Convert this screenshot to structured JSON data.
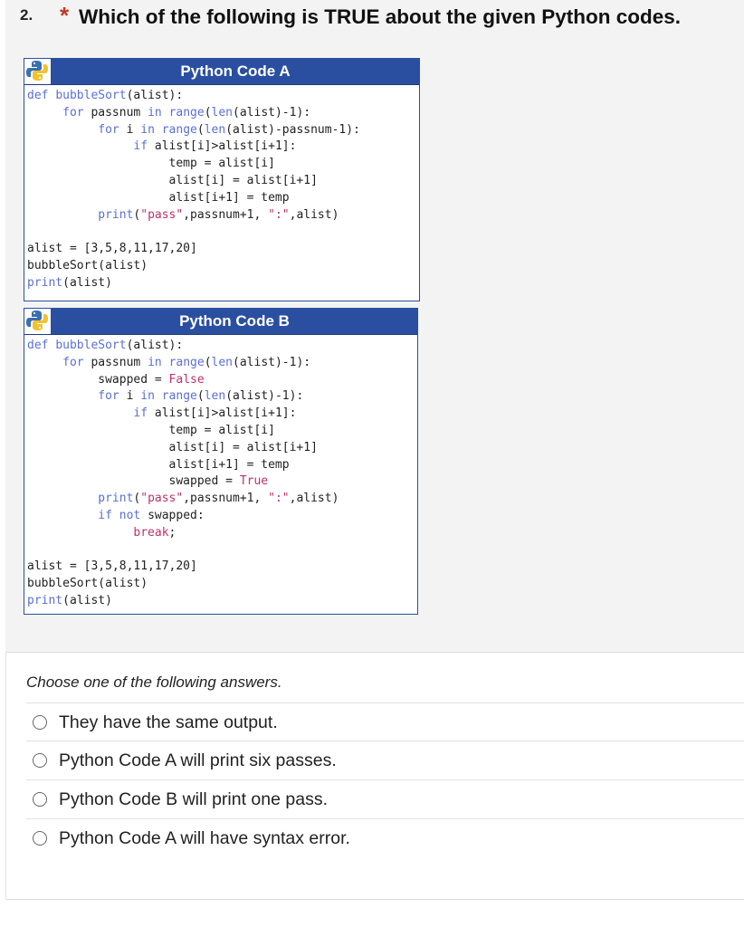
{
  "question": {
    "number": "2.",
    "required_marker": "*",
    "text": "Which of the following is TRUE about the given Python codes."
  },
  "code_a": {
    "title": "Python Code A",
    "lines": [
      [
        [
          "kw",
          "def "
        ],
        [
          "fn",
          "bubbleSort"
        ],
        [
          "",
          "(alist):"
        ]
      ],
      [
        [
          "",
          "     "
        ],
        [
          "kw",
          "for"
        ],
        [
          "",
          " passnum "
        ],
        [
          "kw",
          "in"
        ],
        [
          "",
          " "
        ],
        [
          "fn",
          "range"
        ],
        [
          "",
          "("
        ],
        [
          "fn",
          "len"
        ],
        [
          "",
          "(alist)-1):"
        ]
      ],
      [
        [
          "",
          "          "
        ],
        [
          "kw",
          "for"
        ],
        [
          "",
          " i "
        ],
        [
          "kw",
          "in"
        ],
        [
          "",
          " "
        ],
        [
          "fn",
          "range"
        ],
        [
          "",
          "("
        ],
        [
          "fn",
          "len"
        ],
        [
          "",
          "(alist)-passnum-1):"
        ]
      ],
      [
        [
          "",
          "               "
        ],
        [
          "kw",
          "if"
        ],
        [
          "",
          " alist[i]>alist[i+1]:"
        ]
      ],
      [
        [
          "",
          "                    temp = alist[i]"
        ]
      ],
      [
        [
          "",
          "                    alist[i] = alist[i+1]"
        ]
      ],
      [
        [
          "",
          "                    alist[i+1] = temp"
        ]
      ],
      [
        [
          "",
          "          "
        ],
        [
          "fn",
          "print"
        ],
        [
          "",
          "("
        ],
        [
          "str",
          "\"pass\""
        ],
        [
          "",
          ",passnum+1, "
        ],
        [
          "str",
          "\":\""
        ],
        [
          "",
          ",alist)"
        ]
      ],
      [
        [
          "",
          ""
        ]
      ],
      [
        [
          "",
          "alist = [3,5,8,11,17,20]"
        ]
      ],
      [
        [
          "",
          "bubbleSort(alist)"
        ]
      ],
      [
        [
          "fn",
          "print"
        ],
        [
          "",
          "(alist)"
        ]
      ]
    ]
  },
  "code_b": {
    "title": "Python Code B",
    "lines": [
      [
        [
          "kw",
          "def "
        ],
        [
          "fn",
          "bubbleSort"
        ],
        [
          "",
          "(alist):"
        ]
      ],
      [
        [
          "",
          "     "
        ],
        [
          "kw",
          "for"
        ],
        [
          "",
          " passnum "
        ],
        [
          "kw",
          "in"
        ],
        [
          "",
          " "
        ],
        [
          "fn",
          "range"
        ],
        [
          "",
          "("
        ],
        [
          "fn",
          "len"
        ],
        [
          "",
          "(alist)-1):"
        ]
      ],
      [
        [
          "",
          "          swapped = "
        ],
        [
          "const",
          "False"
        ]
      ],
      [
        [
          "",
          "          "
        ],
        [
          "kw",
          "for"
        ],
        [
          "",
          " i "
        ],
        [
          "kw",
          "in"
        ],
        [
          "",
          " "
        ],
        [
          "fn",
          "range"
        ],
        [
          "",
          "("
        ],
        [
          "fn",
          "len"
        ],
        [
          "",
          "(alist)-1):"
        ]
      ],
      [
        [
          "",
          "               "
        ],
        [
          "kw",
          "if"
        ],
        [
          "",
          " alist[i]>alist[i+1]:"
        ]
      ],
      [
        [
          "",
          "                    temp = alist[i]"
        ]
      ],
      [
        [
          "",
          "                    alist[i] = alist[i+1]"
        ]
      ],
      [
        [
          "",
          "                    alist[i+1] = temp"
        ]
      ],
      [
        [
          "",
          "                    swapped = "
        ],
        [
          "const",
          "True"
        ]
      ],
      [
        [
          "",
          "          "
        ],
        [
          "fn",
          "print"
        ],
        [
          "",
          "("
        ],
        [
          "str",
          "\"pass\""
        ],
        [
          "",
          ",passnum+1, "
        ],
        [
          "str",
          "\":\""
        ],
        [
          "",
          ",alist)"
        ]
      ],
      [
        [
          "",
          "          "
        ],
        [
          "kw",
          "if not"
        ],
        [
          "",
          " swapped:"
        ]
      ],
      [
        [
          "",
          "               "
        ],
        [
          "const",
          "break"
        ],
        [
          "",
          ";"
        ]
      ],
      [
        [
          "",
          ""
        ]
      ],
      [
        [
          "",
          "alist = [3,5,8,11,17,20]"
        ]
      ],
      [
        [
          "",
          "bubbleSort(alist)"
        ]
      ],
      [
        [
          "fn",
          "print"
        ],
        [
          "",
          "(alist)"
        ]
      ]
    ]
  },
  "answers": {
    "prompt": "Choose one of the following answers.",
    "options": [
      "They have the same output.",
      "Python Code A will print six passes.",
      "Python Code B will print one pass.",
      "Python Code A will have syntax error."
    ]
  },
  "icons": {
    "code_logo": "python-logo-icon",
    "option": "radio-button-icon"
  }
}
